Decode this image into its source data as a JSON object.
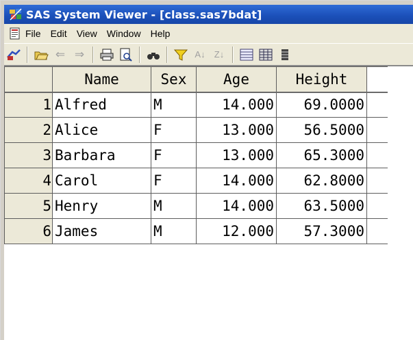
{
  "window": {
    "title": "SAS System Viewer - [class.sas7bdat]",
    "title_color": "#1b4fb8"
  },
  "menubar": {
    "items": [
      "File",
      "Edit",
      "View",
      "Window",
      "Help"
    ]
  },
  "toolbar": {
    "icons": [
      "open-data-icon",
      "open-folder-icon",
      "back-arrow-icon",
      "forward-arrow-icon",
      "print-icon",
      "print-preview-icon",
      "find-icon",
      "filter-icon",
      "sort-ascending-icon",
      "sort-descending-icon",
      "view-columns-icon",
      "view-table-icon",
      "view-grid-icon"
    ]
  },
  "table": {
    "columns": [
      "Name",
      "Sex",
      "Age",
      "Height"
    ],
    "rows": [
      {
        "num": "1",
        "Name": "Alfred",
        "Sex": "M",
        "Age": "14.000",
        "Height": "69.0000"
      },
      {
        "num": "2",
        "Name": "Alice",
        "Sex": "F",
        "Age": "13.000",
        "Height": "56.5000"
      },
      {
        "num": "3",
        "Name": "Barbara",
        "Sex": "F",
        "Age": "13.000",
        "Height": "65.3000"
      },
      {
        "num": "4",
        "Name": "Carol",
        "Sex": "F",
        "Age": "14.000",
        "Height": "62.8000"
      },
      {
        "num": "5",
        "Name": "Henry",
        "Sex": "M",
        "Age": "14.000",
        "Height": "63.5000"
      },
      {
        "num": "6",
        "Name": "James",
        "Sex": "M",
        "Age": "12.000",
        "Height": "57.3000"
      }
    ]
  }
}
